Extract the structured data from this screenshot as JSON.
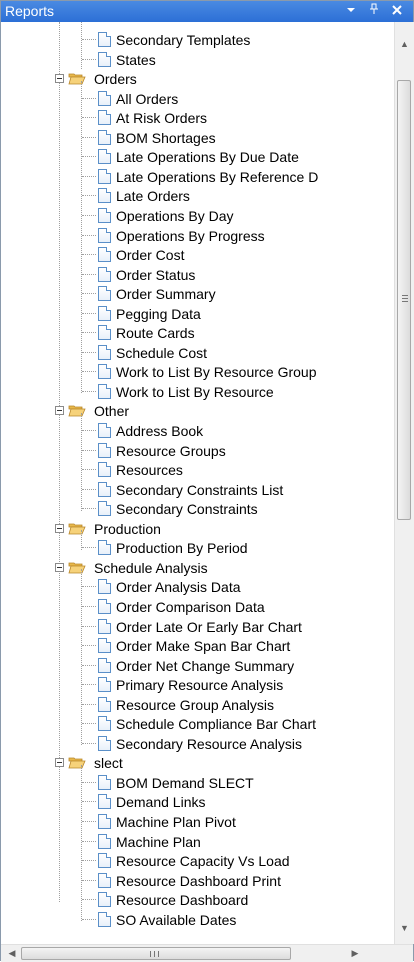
{
  "panel": {
    "title": "Reports",
    "dropdown_icon": "chevron-down-icon",
    "pin_icon": "pin-icon",
    "close_icon": "close-icon"
  },
  "tree": {
    "top_items": [
      "Secondary Templates",
      "States"
    ],
    "groups": [
      {
        "name": "Orders",
        "items": [
          "All Orders",
          "At Risk Orders",
          "BOM Shortages",
          "Late Operations By Due Date",
          "Late Operations By Reference D",
          "Late Orders",
          "Operations By Day",
          "Operations By Progress",
          "Order Cost",
          "Order Status",
          "Order Summary",
          "Pegging Data",
          "Route Cards",
          "Schedule Cost",
          "Work to List By Resource Group",
          "Work to List By Resource"
        ]
      },
      {
        "name": "Other",
        "items": [
          "Address Book",
          "Resource Groups",
          "Resources",
          "Secondary Constraints List",
          "Secondary Constraints"
        ]
      },
      {
        "name": "Production",
        "items": [
          "Production By Period"
        ]
      },
      {
        "name": "Schedule Analysis",
        "items": [
          "Order Analysis Data",
          "Order Comparison Data",
          "Order Late Or Early Bar Chart",
          "Order Make Span Bar Chart",
          "Order Net Change Summary",
          "Primary Resource Analysis",
          "Resource Group Analysis",
          "Schedule Compliance Bar Chart",
          "Secondary Resource Analysis"
        ]
      },
      {
        "name": "slect",
        "items": [
          "BOM Demand SLECT",
          "Demand Links",
          "Machine Plan Pivot",
          "Machine Plan",
          "Resource Capacity Vs Load",
          "Resource Dashboard Print",
          "Resource Dashboard",
          "SO Available Dates"
        ]
      }
    ]
  },
  "scrollbars": {
    "vertical_grip_icon": "grip-icon",
    "horizontal_grip_icon": "grip-icon"
  }
}
